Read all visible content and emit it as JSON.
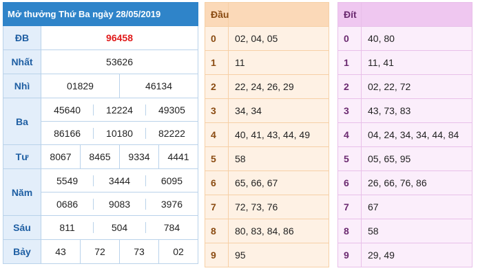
{
  "results": {
    "title": "Mở thưởng Thứ Ba ngày 28/05/2019",
    "prizes": {
      "db": {
        "label": "ĐB",
        "values": [
          "96458"
        ]
      },
      "nhat": {
        "label": "Nhất",
        "values": [
          "53626"
        ]
      },
      "nhi": {
        "label": "Nhì",
        "values": [
          "01829",
          "46134"
        ]
      },
      "ba": {
        "label": "Ba",
        "values": [
          "45640",
          "12224",
          "49305",
          "86166",
          "10180",
          "82222"
        ]
      },
      "tu": {
        "label": "Tư",
        "values": [
          "8067",
          "8465",
          "9334",
          "4441"
        ]
      },
      "nam": {
        "label": "Năm",
        "values": [
          "5549",
          "3444",
          "6095",
          "0686",
          "9083",
          "3976"
        ]
      },
      "sau": {
        "label": "Sáu",
        "values": [
          "811",
          "504",
          "784"
        ]
      },
      "bay": {
        "label": "Bảy",
        "values": [
          "43",
          "72",
          "73",
          "02"
        ]
      }
    }
  },
  "head": {
    "header": "Đầu",
    "rows": [
      {
        "d": "0",
        "v": "02, 04, 05"
      },
      {
        "d": "1",
        "v": "11"
      },
      {
        "d": "2",
        "v": "22, 24, 26, 29"
      },
      {
        "d": "3",
        "v": "34, 34"
      },
      {
        "d": "4",
        "v": "40, 41, 43, 44, 49"
      },
      {
        "d": "5",
        "v": "58"
      },
      {
        "d": "6",
        "v": "65, 66, 67"
      },
      {
        "d": "7",
        "v": "72, 73, 76"
      },
      {
        "d": "8",
        "v": "80, 83, 84, 86"
      },
      {
        "d": "9",
        "v": "95"
      }
    ]
  },
  "tail": {
    "header": "Đít",
    "rows": [
      {
        "d": "0",
        "v": "40, 80"
      },
      {
        "d": "1",
        "v": "11, 41"
      },
      {
        "d": "2",
        "v": "02, 22, 72"
      },
      {
        "d": "3",
        "v": "43, 73, 83"
      },
      {
        "d": "4",
        "v": "04, 24, 34, 34, 44, 84"
      },
      {
        "d": "5",
        "v": "05, 65, 95"
      },
      {
        "d": "6",
        "v": "26, 66, 76, 86"
      },
      {
        "d": "7",
        "v": "67"
      },
      {
        "d": "8",
        "v": "58"
      },
      {
        "d": "9",
        "v": "29, 49"
      }
    ]
  }
}
